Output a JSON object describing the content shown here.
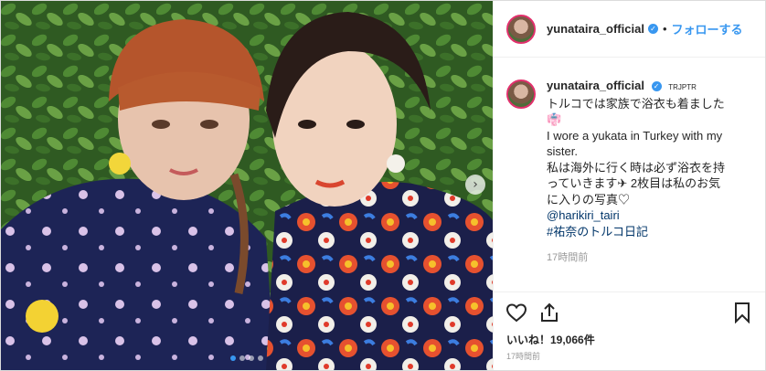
{
  "header": {
    "username": "yunataira_official",
    "verified_icon": "check-badge-icon",
    "separator": "•",
    "follow_label": "フォローする"
  },
  "caption": {
    "username": "yunataira_official",
    "tag": "TRJPTR",
    "line1": "トルコでは家族で浴衣も着ました",
    "line2": "I wore a yukata in Turkey with my sister.",
    "line3": "私は海外に行く時は必ず浴衣を持っていきます",
    "line3b": " 2枚目は私のお気に入りの写真",
    "mention": "@harikiri_tairi",
    "hashtag": "#祐奈のトルコ日記",
    "time": "17時間前"
  },
  "media": {
    "photo_icon": "photo-image",
    "next_icon": "chevron-right-icon",
    "slides": 4,
    "active_slide": 1
  },
  "footer": {
    "likes": "いいね！19,066件",
    "time": "17時間前",
    "like_icon": "heart-icon",
    "share_icon": "share-icon",
    "save_icon": "bookmark-icon"
  },
  "colors": {
    "accent": "#3897f0",
    "text": "#262626",
    "muted": "#999999"
  }
}
